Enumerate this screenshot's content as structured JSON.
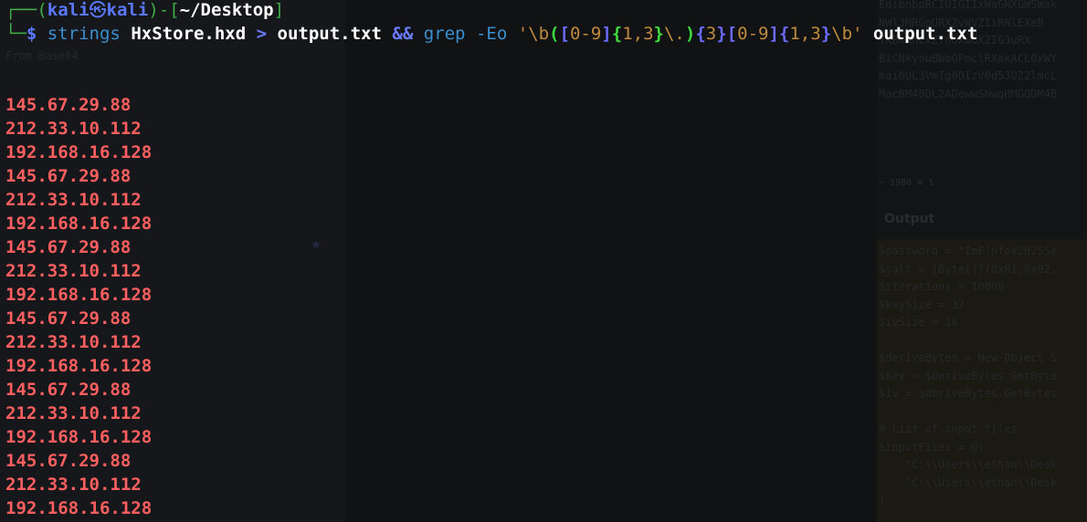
{
  "prompt": {
    "bracket_open": "┌──(",
    "user": "kali",
    "skull": "㉿",
    "host": "kali",
    "bracket_mid": ")-[",
    "path": "~/Desktop",
    "bracket_close": "]",
    "corner": "└─",
    "dollar": "$"
  },
  "command": {
    "cmd1": "strings",
    "file": "HxStore.hxd",
    "redirect": ">",
    "outfile": "output.txt",
    "and": "&&",
    "cmd2": "grep",
    "flag": "-Eo",
    "pattern_parts": [
      "'\\b",
      "(",
      "[",
      "0-9",
      "]",
      "{",
      "1,3",
      "}",
      "\\.",
      ")",
      "{",
      "3",
      "}",
      "[",
      "0-9",
      "]",
      "{",
      "1,3",
      "}",
      "\\b'"
    ],
    "arg2": "output.txt"
  },
  "output_lines": [
    "145.67.29.88",
    "212.33.10.112",
    "192.168.16.128",
    "145.67.29.88",
    "212.33.10.112",
    "192.168.16.128",
    "145.67.29.88",
    "212.33.10.112",
    "192.168.16.128",
    "145.67.29.88",
    "212.33.10.112",
    "192.168.16.128",
    "145.67.29.88",
    "212.33.10.112",
    "192.168.16.128",
    "145.67.29.88",
    "212.33.10.112",
    "192.168.16.128"
  ],
  "background": {
    "left_label": "From Base64",
    "output_header": "Output",
    "status": "⋯ 1980   ≡ 1",
    "top_right_lines": [
      "EdibnbpRCIUIGIIxWaGNXGWSWak",
      "NWlJMRGpURXZvWVZIiRNlEXeB",
      "YXBkRncxZYnOXwdX2IG3uRX",
      "BiCNkyouBWaGFmclRXakACL0xWY",
      "mai0UL3VmTg0DIzV0d5JU22lmcL",
      "MacBM48DL2ADewwSNwgHMGQDM4B"
    ],
    "code_lines": [
      "$password = \"ImF!nfo#2025Se",
      "$salt = [Byte[]](0x01,0x02,",
      "$iterations = 10000",
      "$keySize = 32",
      "$ivSize = 16",
      "",
      "$deriveBytes = New-Object S",
      "$key = $deriveBytes.GetByte",
      "$iv = $deriveBytes.GetBytes",
      "",
      "# List of input files",
      "$inputFiles = @(",
      "    \"C:\\\\Users\\\\ethan\\\\Desk",
      "    \"C:\\\\Users\\\\ethan\\\\Desk",
      ")"
    ]
  },
  "colors": {
    "output_red": "#ff5f5f",
    "prompt_green": "#3fae46",
    "prompt_blue": "#5a78ff",
    "command_cyan": "#3b8fcf"
  }
}
